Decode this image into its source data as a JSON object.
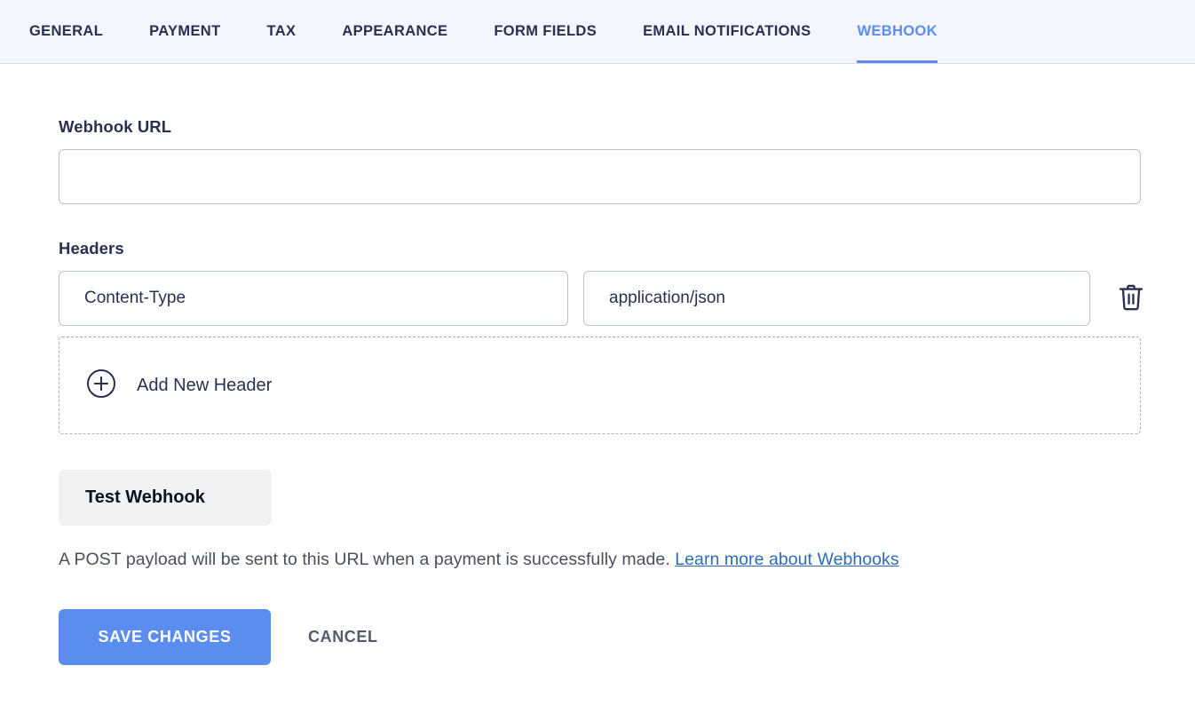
{
  "tabs": [
    {
      "label": "GENERAL",
      "active": false
    },
    {
      "label": "PAYMENT",
      "active": false
    },
    {
      "label": "TAX",
      "active": false
    },
    {
      "label": "APPEARANCE",
      "active": false
    },
    {
      "label": "FORM FIELDS",
      "active": false
    },
    {
      "label": "EMAIL NOTIFICATIONS",
      "active": false
    },
    {
      "label": "WEBHOOK",
      "active": true
    }
  ],
  "webhook": {
    "url_label": "Webhook URL",
    "url_value": "",
    "url_placeholder": "",
    "headers_label": "Headers",
    "headers": [
      {
        "key": "Content-Type",
        "value": "application/json"
      }
    ],
    "add_header_label": "Add New Header",
    "add_header_icon": "plus-circle-icon",
    "delete_icon": "trash-icon",
    "test_button_label": "Test Webhook",
    "description_text": "A POST payload will be sent to this URL when a payment is successfully made.",
    "description_link": "Learn more about Webhooks"
  },
  "actions": {
    "save_label": "SAVE CHANGES",
    "cancel_label": "CANCEL"
  },
  "colors": {
    "accent": "#5b8def",
    "tab_bar_bg": "#f4f6fd",
    "text_dark": "#2b3050",
    "link": "#2b6cb8",
    "test_button_bg": "#f1f2f4"
  }
}
